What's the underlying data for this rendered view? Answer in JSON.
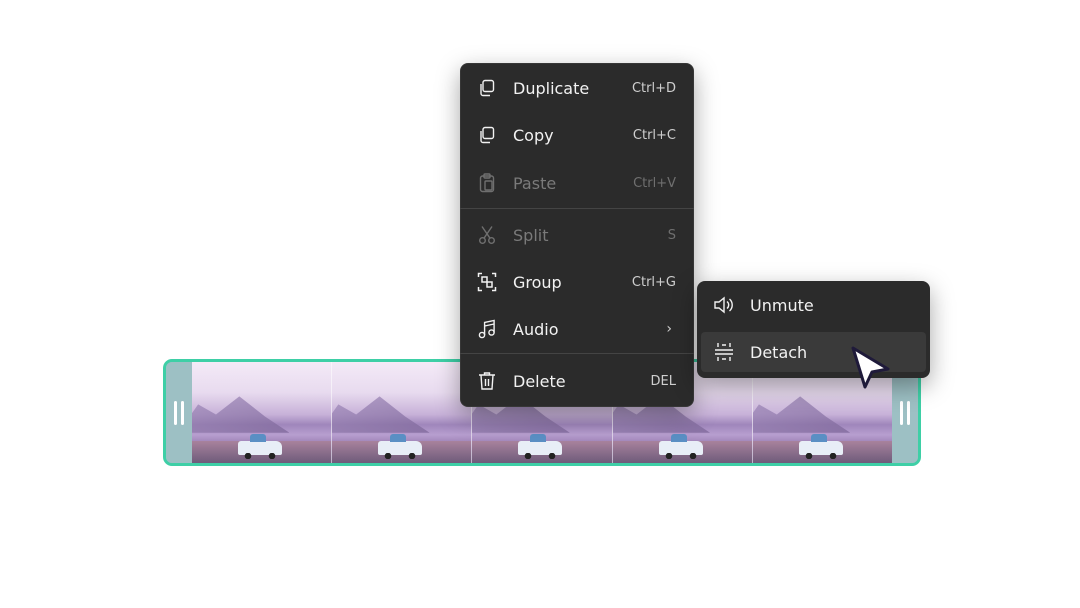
{
  "menu": {
    "items": [
      {
        "label": "Duplicate",
        "shortcut": "Ctrl+D",
        "icon": "duplicate-icon",
        "enabled": true
      },
      {
        "label": "Copy",
        "shortcut": "Ctrl+C",
        "icon": "copy-icon",
        "enabled": true
      },
      {
        "label": "Paste",
        "shortcut": "Ctrl+V",
        "icon": "paste-icon",
        "enabled": false
      },
      {
        "label": "Split",
        "shortcut": "S",
        "icon": "scissors-icon",
        "enabled": false
      },
      {
        "label": "Group",
        "shortcut": "Ctrl+G",
        "icon": "group-icon",
        "enabled": true
      },
      {
        "label": "Audio",
        "icon": "music-note-icon",
        "enabled": true,
        "has_submenu": true
      },
      {
        "label": "Delete",
        "shortcut": "DEL",
        "icon": "trash-icon",
        "enabled": true
      }
    ]
  },
  "submenu": {
    "items": [
      {
        "label": "Unmute",
        "icon": "speaker-icon"
      },
      {
        "label": "Detach",
        "icon": "detach-icon",
        "hovered": true
      }
    ]
  },
  "timeline": {
    "clip_frames": 5,
    "accent_color": "#3ecfa6"
  },
  "colors": {
    "menu_background": "#2b2b2b",
    "menu_text": "#f2f2f2",
    "disabled_text": "#7a7a7a"
  }
}
